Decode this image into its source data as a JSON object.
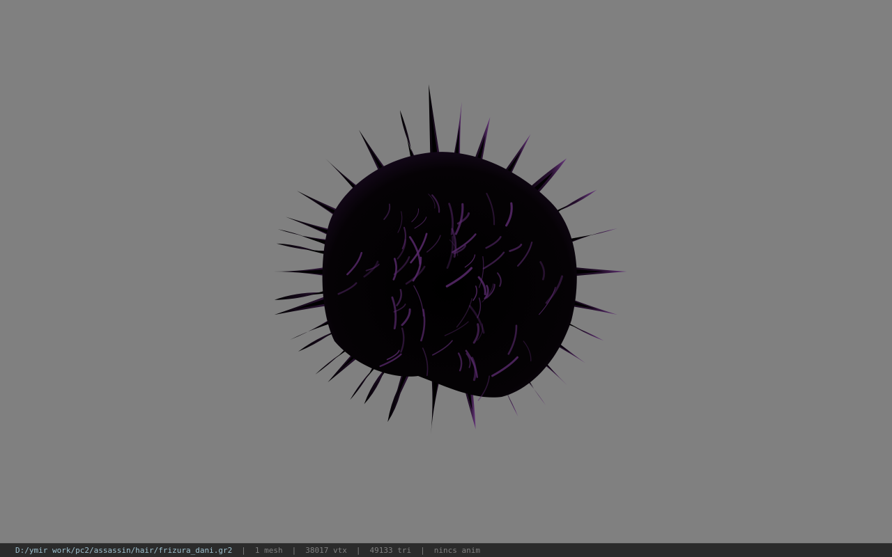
{
  "viewport": {
    "background_color": "#808080",
    "model": {
      "description": "hair-mesh-render",
      "base_color": "#000000",
      "highlight_color": "#5a2a6e"
    }
  },
  "status_bar": {
    "file_path": "D:/ymir work/pc2/assassin/hair/frizura_dani.gr2",
    "separator": "|",
    "mesh_count": "1 mesh",
    "vertex_count": "38017 vtx",
    "triangle_count": "49133 tri",
    "animation_status": "nincs anim",
    "path_color": "#9ec0ce",
    "text_color": "#7f7f7f"
  }
}
